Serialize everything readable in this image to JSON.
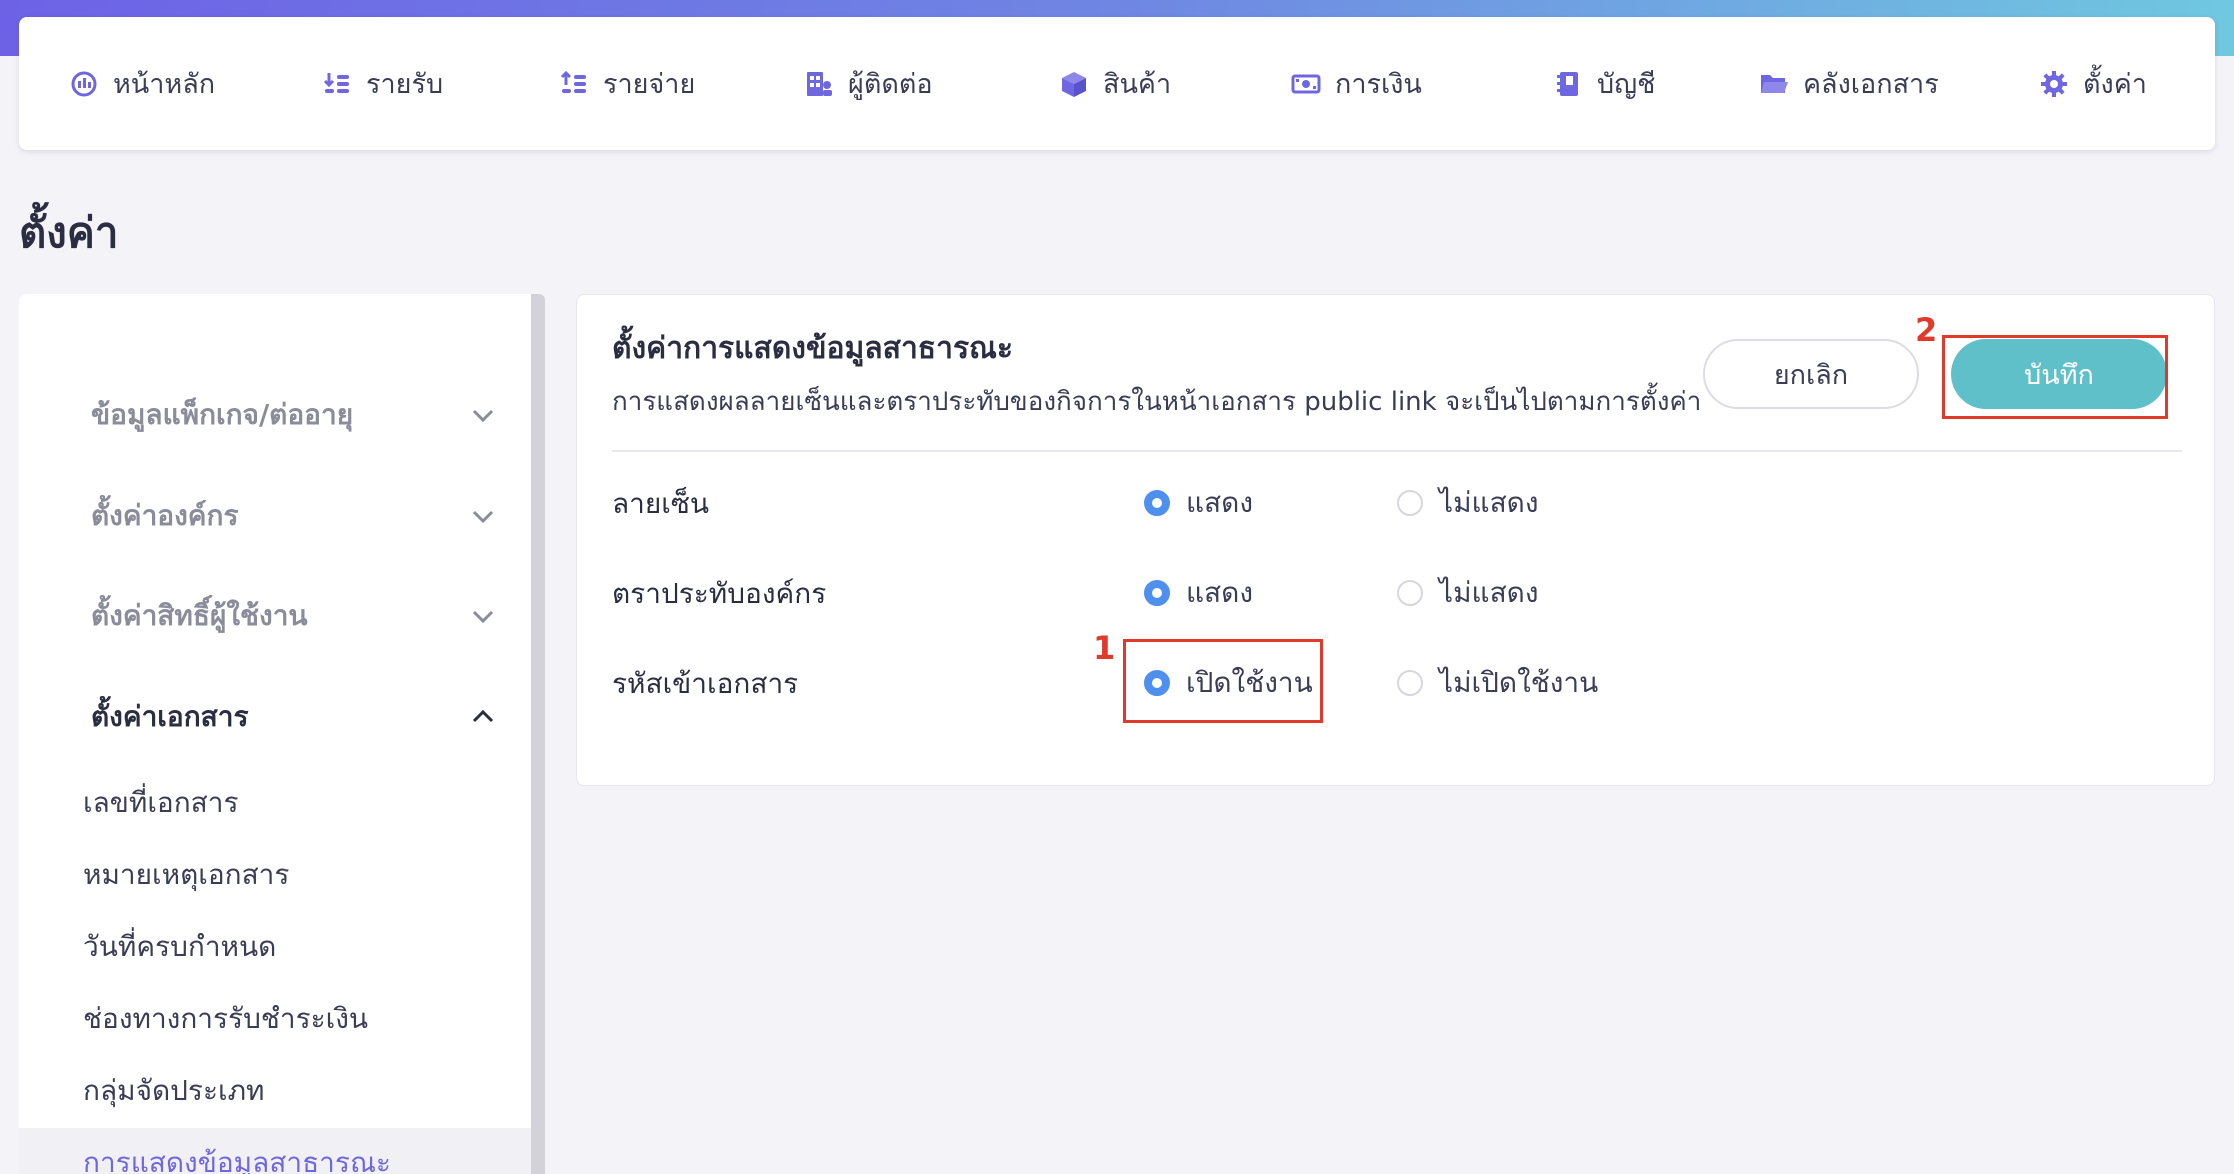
{
  "nav": {
    "items": [
      {
        "label": "หน้าหลัก",
        "icon": "dashboard-icon"
      },
      {
        "label": "รายรับ",
        "icon": "income-icon"
      },
      {
        "label": "รายจ่าย",
        "icon": "expense-icon"
      },
      {
        "label": "ผู้ติดต่อ",
        "icon": "contacts-icon"
      },
      {
        "label": "สินค้า",
        "icon": "product-box-icon"
      },
      {
        "label": "การเงิน",
        "icon": "money-icon"
      },
      {
        "label": "บัญชี",
        "icon": "accounting-book-icon"
      },
      {
        "label": "คลังเอกสาร",
        "icon": "folder-icon"
      },
      {
        "label": "ตั้งค่า",
        "icon": "gear-icon"
      }
    ]
  },
  "page": {
    "title": "ตั้งค่า"
  },
  "sidebar": {
    "groups": [
      {
        "label": "ข้อมูลแพ็กเกจ/ต่ออายุ",
        "expanded": false
      },
      {
        "label": "ตั้งค่าองค์กร",
        "expanded": false
      },
      {
        "label": "ตั้งค่าสิทธิ์ผู้ใช้งาน",
        "expanded": false
      },
      {
        "label": "ตั้งค่าเอกสาร",
        "expanded": true
      }
    ],
    "subitems": [
      {
        "label": "เลขที่เอกสาร"
      },
      {
        "label": "หมายเหตุเอกสาร"
      },
      {
        "label": "วันที่ครบกำหนด"
      },
      {
        "label": "ช่องทางการรับชำระเงิน"
      },
      {
        "label": "กลุ่มจัดประเภท"
      },
      {
        "label": "การแสดงข้อมูลสาธารณะ",
        "active": true
      }
    ]
  },
  "card": {
    "title": "ตั้งค่าการแสดงข้อมูลสาธารณะ",
    "description": "การแสดงผลลายเซ็นและตราประทับของกิจการในหน้าเอกสาร public link จะเป็นไปตามการตั้งค่า",
    "cancel_label": "ยกเลิก",
    "save_label": "บันทึก",
    "rows": [
      {
        "label": "ลายเซ็น",
        "on": "แสดง",
        "off": "ไม่แสดง",
        "selected": "on"
      },
      {
        "label": "ตราประทับองค์กร",
        "on": "แสดง",
        "off": "ไม่แสดง",
        "selected": "on"
      },
      {
        "label": "รหัสเข้าเอกสาร",
        "on": "เปิดใช้งาน",
        "off": "ไม่เปิดใช้งาน",
        "selected": "on"
      }
    ]
  },
  "annotations": {
    "step1": "1",
    "step2": "2",
    "color": "#e03a2a"
  },
  "colors": {
    "accent": "#6f67e0",
    "save_button": "#5fc0c9",
    "radio_checked": "#4f8fee"
  }
}
